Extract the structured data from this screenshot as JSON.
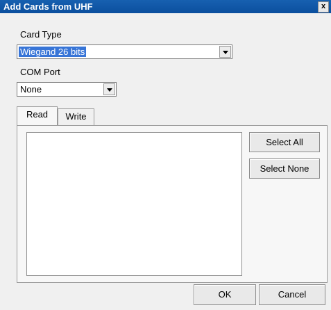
{
  "window": {
    "title": "Add Cards from UHF",
    "close_glyph": "x"
  },
  "card_type": {
    "label": "Card Type",
    "value": "Wiegand 26 bits"
  },
  "com_port": {
    "label": "COM Port",
    "value": "None"
  },
  "tabs": [
    {
      "label": "Read",
      "active": true
    },
    {
      "label": "Write",
      "active": false
    }
  ],
  "actions": {
    "select_all": "Select All",
    "select_none": "Select None"
  },
  "footer": {
    "ok": "OK",
    "cancel": "Cancel"
  }
}
